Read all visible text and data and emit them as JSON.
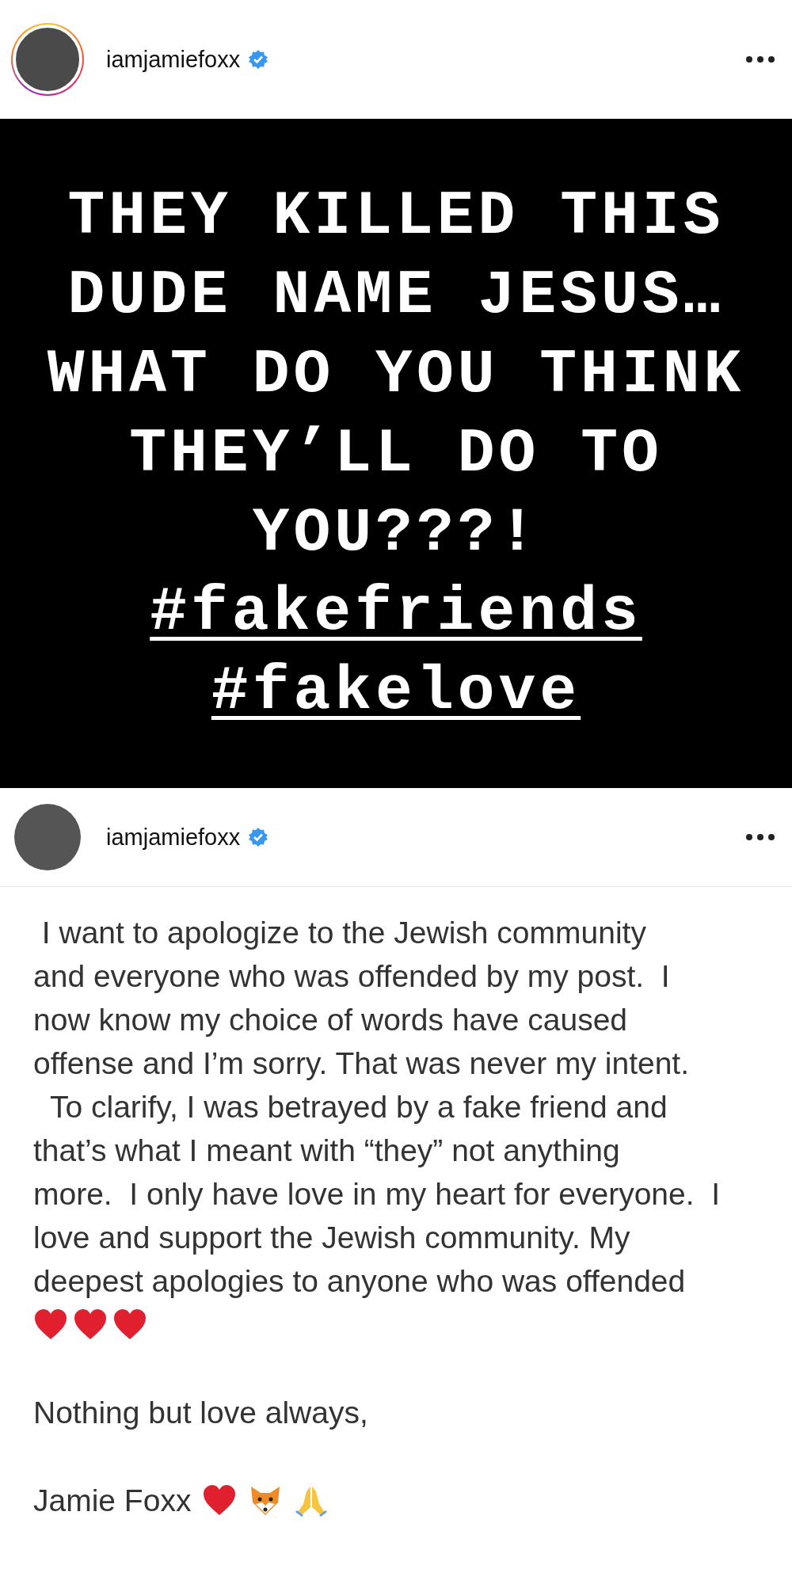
{
  "posts": [
    {
      "kind": "image",
      "username": "iamjamiefoxx",
      "verified": true,
      "story_ring": true,
      "image_lines": [
        {
          "text": "THEY KILLED THIS",
          "kind": "text"
        },
        {
          "text": "DUDE NAME JESUS…",
          "kind": "text"
        },
        {
          "text": "WHAT DO YOU THINK",
          "kind": "text"
        },
        {
          "text": "THEY’LL DO TO",
          "kind": "text"
        },
        {
          "text": "YOU???!",
          "kind": "text"
        },
        {
          "text": "#fakefriends",
          "kind": "hashtag"
        },
        {
          "text": "#fakelove",
          "kind": "hashtag"
        }
      ]
    },
    {
      "kind": "caption",
      "username": "iamjamiefoxx",
      "verified": true,
      "story_ring": false,
      "paragraphs": [
        {
          "kind": "text",
          "lines": [
            " I want to apologize to the Jewish community",
            "and everyone who was offended by my post.  I",
            "now know my choice of words have caused",
            "offense and I’m sorry. That was never my intent.",
            "  To clarify, I was betrayed by a fake friend and",
            "that’s what I meant with “they” not anything",
            "more.  I only have love in my heart for everyone.  I",
            "love and support the Jewish community. My",
            "deepest apologies to anyone who was offended"
          ],
          "icons": [
            {
              "kind": "heart"
            },
            {
              "kind": "heart"
            },
            {
              "kind": "heart"
            }
          ]
        },
        {
          "kind": "text",
          "lines": [
            "Nothing but love always,"
          ]
        },
        {
          "kind": "signature",
          "lines": [
            "Jamie Foxx"
          ],
          "icons": [
            {
              "kind": "heart"
            },
            {
              "kind": "fox"
            },
            {
              "kind": "pray"
            }
          ]
        }
      ]
    }
  ]
}
